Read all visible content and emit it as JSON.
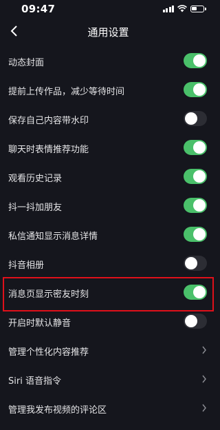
{
  "status_bar": {
    "time": "09:47"
  },
  "header": {
    "title": "通用设置"
  },
  "settings": [
    {
      "label": "动态封面",
      "type": "toggle",
      "on": true
    },
    {
      "label": "提前上传作品，减少等待时间",
      "type": "toggle",
      "on": true
    },
    {
      "label": "保存自己内容带水印",
      "type": "toggle",
      "on": false
    },
    {
      "label": "聊天时表情推荐功能",
      "type": "toggle",
      "on": true
    },
    {
      "label": "观看历史记录",
      "type": "toggle",
      "on": true
    },
    {
      "label": "抖一抖加朋友",
      "type": "toggle",
      "on": true
    },
    {
      "label": "私信通知显示消息详情",
      "type": "toggle",
      "on": true
    },
    {
      "label": "抖音相册",
      "type": "toggle",
      "on": false
    },
    {
      "label": "消息页显示密友时刻",
      "type": "toggle",
      "on": true
    },
    {
      "label": "开启时默认静音",
      "type": "toggle",
      "on": false
    },
    {
      "label": "管理个性化内容推荐",
      "type": "link"
    },
    {
      "label": "Siri 语音指令",
      "type": "link"
    },
    {
      "label": "管理我发布视频的评论区",
      "type": "link"
    }
  ],
  "colors": {
    "background": "#15161d",
    "toggle_on": "#4ac06a",
    "toggle_off": "#2c2d34",
    "highlight": "#e0101a"
  },
  "icons": {
    "back": "chevron-left-icon",
    "link": "chevron-right-icon",
    "wifi": "wifi-icon",
    "battery": "battery-icon",
    "signal": "signal-icon"
  }
}
